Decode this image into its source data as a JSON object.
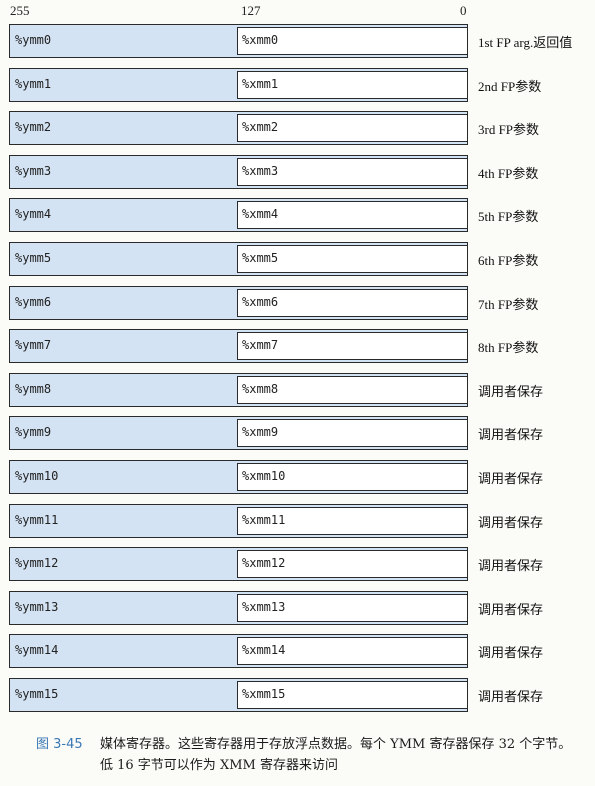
{
  "bit_labels": {
    "high": "255",
    "mid": "127",
    "low": "0"
  },
  "registers": [
    {
      "ymm": "%ymm0",
      "xmm": "%xmm0",
      "desc": "1st FP arg.返回值"
    },
    {
      "ymm": "%ymm1",
      "xmm": "%xmm1",
      "desc": "2nd FP参数"
    },
    {
      "ymm": "%ymm2",
      "xmm": "%xmm2",
      "desc": "3rd FP参数"
    },
    {
      "ymm": "%ymm3",
      "xmm": "%xmm3",
      "desc": "4th FP参数"
    },
    {
      "ymm": "%ymm4",
      "xmm": "%xmm4",
      "desc": "5th FP参数"
    },
    {
      "ymm": "%ymm5",
      "xmm": "%xmm5",
      "desc": "6th FP参数"
    },
    {
      "ymm": "%ymm6",
      "xmm": "%xmm6",
      "desc": "7th FP参数"
    },
    {
      "ymm": "%ymm7",
      "xmm": "%xmm7",
      "desc": "8th FP参数"
    },
    {
      "ymm": "%ymm8",
      "xmm": "%xmm8",
      "desc": "调用者保存"
    },
    {
      "ymm": "%ymm9",
      "xmm": "%xmm9",
      "desc": "调用者保存"
    },
    {
      "ymm": "%ymm10",
      "xmm": "%xmm10",
      "desc": "调用者保存"
    },
    {
      "ymm": "%ymm11",
      "xmm": "%xmm11",
      "desc": "调用者保存"
    },
    {
      "ymm": "%ymm12",
      "xmm": "%xmm12",
      "desc": "调用者保存"
    },
    {
      "ymm": "%ymm13",
      "xmm": "%xmm13",
      "desc": "调用者保存"
    },
    {
      "ymm": "%ymm14",
      "xmm": "%xmm14",
      "desc": "调用者保存"
    },
    {
      "ymm": "%ymm15",
      "xmm": "%xmm15",
      "desc": "调用者保存"
    }
  ],
  "caption": {
    "number": "图 3-45",
    "text": "媒体寄存器。这些寄存器用于存放浮点数据。每个 YMM 寄存器保存 32 个字节。低 16 字节可以作为 XMM 寄存器来访问"
  },
  "colors": {
    "ymm_fill": "#d4e3f3",
    "xmm_fill": "#ffffff",
    "caption_number": "#3a78b5"
  }
}
